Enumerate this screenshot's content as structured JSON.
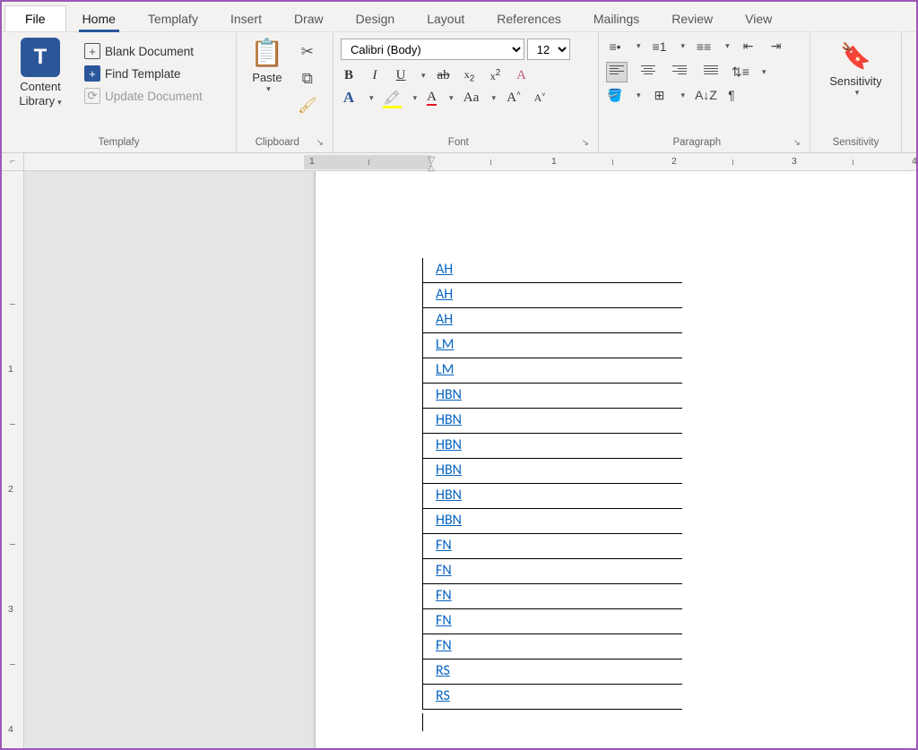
{
  "menu": {
    "file": "File",
    "items": [
      "Home",
      "Templafy",
      "Insert",
      "Draw",
      "Design",
      "Layout",
      "References",
      "Mailings",
      "Review",
      "View"
    ],
    "active_index": 0
  },
  "ribbon": {
    "templafy": {
      "title": "Templafy",
      "content_library_label": "Content Library",
      "blank_doc": "Blank Document",
      "find_template": "Find Template",
      "update_doc": "Update Document"
    },
    "clipboard": {
      "title": "Clipboard",
      "paste_label": "Paste"
    },
    "font": {
      "title": "Font",
      "name": "Calibri (Body)",
      "size": "12"
    },
    "paragraph": {
      "title": "Paragraph"
    },
    "sensitivity": {
      "title": "Sensitivity",
      "label": "Sensitivity"
    }
  },
  "ruler": {
    "h_numbers": [
      1,
      2,
      3,
      4
    ],
    "v_numbers": [
      1,
      2,
      3,
      4
    ]
  },
  "document": {
    "rows": [
      "AH",
      "AH",
      "AH",
      "LM",
      "LM",
      "HBN",
      "HBN",
      "HBN",
      "HBN",
      "HBN",
      "HBN",
      "FN",
      "FN",
      "FN",
      "FN",
      "FN",
      "RS",
      "RS"
    ]
  }
}
